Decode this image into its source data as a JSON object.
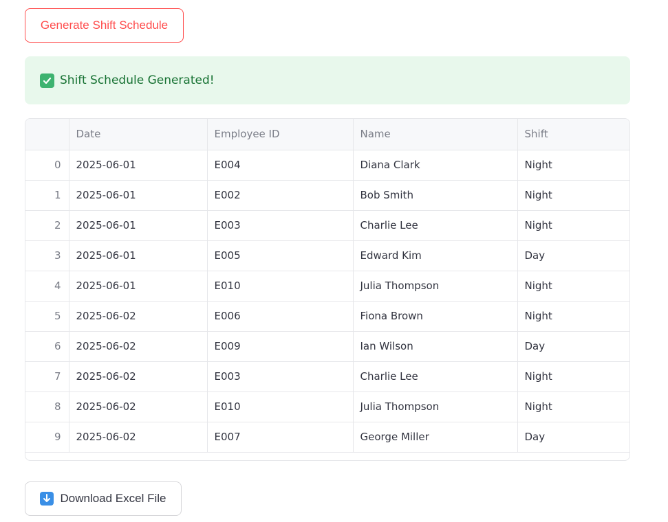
{
  "generate_button": {
    "label": "Generate Shift Schedule"
  },
  "alert": {
    "icon": "check-icon",
    "text": "Shift Schedule Generated!",
    "color": "#177233",
    "background": "#e8f8ec"
  },
  "table": {
    "columns": [
      "",
      "Date",
      "Employee ID",
      "Name",
      "Shift"
    ],
    "rows": [
      {
        "index": "0",
        "date": "2025-06-01",
        "employee_id": "E004",
        "name": "Diana Clark",
        "shift": "Night"
      },
      {
        "index": "1",
        "date": "2025-06-01",
        "employee_id": "E002",
        "name": "Bob Smith",
        "shift": "Night"
      },
      {
        "index": "2",
        "date": "2025-06-01",
        "employee_id": "E003",
        "name": "Charlie Lee",
        "shift": "Night"
      },
      {
        "index": "3",
        "date": "2025-06-01",
        "employee_id": "E005",
        "name": "Edward Kim",
        "shift": "Day"
      },
      {
        "index": "4",
        "date": "2025-06-01",
        "employee_id": "E010",
        "name": "Julia Thompson",
        "shift": "Night"
      },
      {
        "index": "5",
        "date": "2025-06-02",
        "employee_id": "E006",
        "name": "Fiona Brown",
        "shift": "Night"
      },
      {
        "index": "6",
        "date": "2025-06-02",
        "employee_id": "E009",
        "name": "Ian Wilson",
        "shift": "Day"
      },
      {
        "index": "7",
        "date": "2025-06-02",
        "employee_id": "E003",
        "name": "Charlie Lee",
        "shift": "Night"
      },
      {
        "index": "8",
        "date": "2025-06-02",
        "employee_id": "E010",
        "name": "Julia Thompson",
        "shift": "Night"
      },
      {
        "index": "9",
        "date": "2025-06-02",
        "employee_id": "E007",
        "name": "George Miller",
        "shift": "Day"
      }
    ]
  },
  "download_button": {
    "icon": "download-arrow-icon",
    "label": "Download Excel File"
  },
  "colors": {
    "accent": "#ff4b4b",
    "success": "#177233",
    "download_icon": "#3a8fe6"
  }
}
